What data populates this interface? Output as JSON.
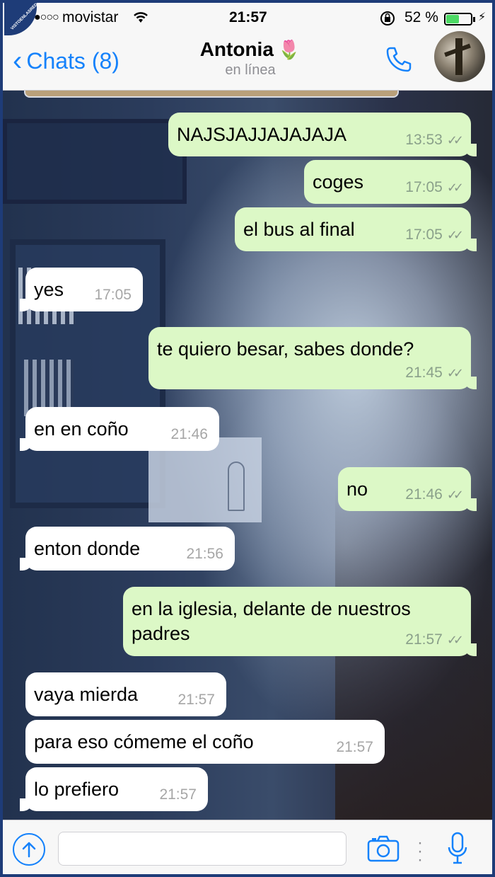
{
  "watermark": "VISTOENLASREDES",
  "status_bar": {
    "carrier": "movistar",
    "time": "21:57",
    "battery_pct": "52 %",
    "battery_level": 0.52
  },
  "nav": {
    "back_label": "Chats (8)",
    "contact_name": "Antonia",
    "contact_emoji": "🌷",
    "presence": "en línea"
  },
  "messages": [
    {
      "dir": "out",
      "text": "NAJSJAJJAJAJAJA",
      "time": "13:53",
      "status": "read"
    },
    {
      "dir": "out",
      "text": "coges",
      "time": "17:05",
      "status": "read"
    },
    {
      "dir": "out",
      "text": "el bus al final",
      "time": "17:05",
      "status": "read"
    },
    {
      "dir": "in",
      "text": "yes",
      "time": "17:05"
    },
    {
      "dir": "out",
      "text": "te quiero besar, sabes donde?",
      "time": "21:45",
      "status": "read"
    },
    {
      "dir": "in",
      "text": "en en coño",
      "time": "21:46"
    },
    {
      "dir": "out",
      "text": "no",
      "time": "21:46",
      "status": "read"
    },
    {
      "dir": "in",
      "text": "enton donde",
      "time": "21:56"
    },
    {
      "dir": "out",
      "text": "en la iglesia, delante de nuestros padres",
      "time": "21:57",
      "status": "read"
    },
    {
      "dir": "in",
      "text": "vaya mierda",
      "time": "21:57"
    },
    {
      "dir": "in",
      "text": "para eso cómeme el coño",
      "time": "21:57"
    },
    {
      "dir": "in",
      "text": "lo prefiero",
      "time": "21:57"
    }
  ],
  "composer": {
    "placeholder": ""
  },
  "colors": {
    "accent": "#1582fb",
    "outgoing_bubble": "#dcf8c6",
    "incoming_bubble": "#ffffff",
    "nav_bg": "#f7f7f7"
  }
}
